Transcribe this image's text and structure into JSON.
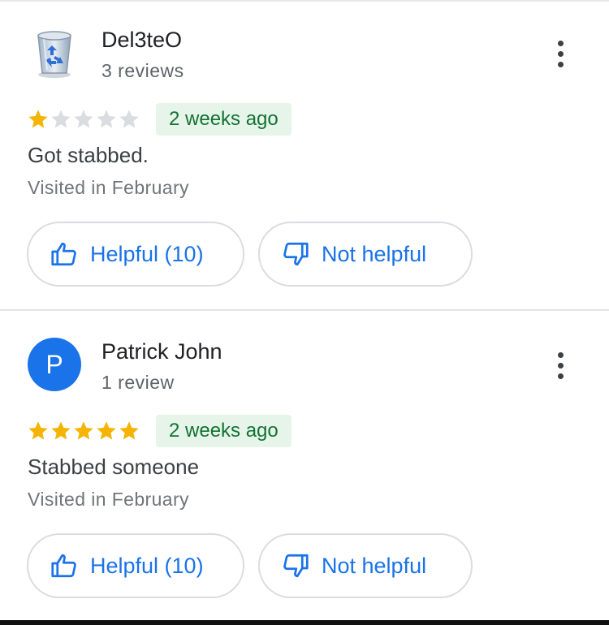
{
  "reviews": [
    {
      "author": "Del3teO",
      "review_count": "3 reviews",
      "avatar": {
        "type": "image",
        "icon": "recycle-bin-icon"
      },
      "rating": 1,
      "max_rating": 5,
      "time_ago": "2 weeks ago",
      "text": "Got stabbed.",
      "visited": "Visited in February",
      "helpful_label": "Helpful (10)",
      "not_helpful_label": "Not helpful"
    },
    {
      "author": "Patrick John",
      "review_count": "1 review",
      "avatar": {
        "type": "letter",
        "letter": "P",
        "color": "#1a73e8"
      },
      "rating": 5,
      "max_rating": 5,
      "time_ago": "2 weeks ago",
      "text": "Stabbed someone",
      "visited": "Visited in February",
      "helpful_label": "Helpful (10)",
      "not_helpful_label": "Not helpful"
    }
  ],
  "colors": {
    "star_filled": "#f5b400",
    "star_empty": "#dadce0",
    "accent": "#1a73e8",
    "badge_bg": "#e6f4ea",
    "badge_text": "#137333"
  },
  "icons": {
    "more": "more-vert-icon",
    "helpful": "thumb-up-icon",
    "not_helpful": "thumb-down-icon"
  }
}
